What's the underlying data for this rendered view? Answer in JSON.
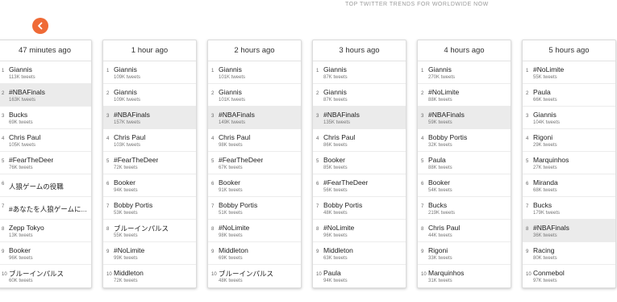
{
  "header": {
    "caption": "TOP TWITTER TRENDS FOR WORLDWIDE NOW"
  },
  "columns": [
    {
      "title": "47 minutes ago",
      "items": [
        {
          "rank": "1",
          "name": "Giannis",
          "count": "113K tweets"
        },
        {
          "rank": "2",
          "name": "#NBAFinals",
          "count": "163K tweets"
        },
        {
          "rank": "3",
          "name": "Bucks",
          "count": "69K tweets"
        },
        {
          "rank": "4",
          "name": "Chris Paul",
          "count": "105K tweets"
        },
        {
          "rank": "5",
          "name": "#FearTheDeer",
          "count": "76K tweets"
        },
        {
          "rank": "6",
          "name": "人狼ゲームの役職",
          "count": ""
        },
        {
          "rank": "7",
          "name": "#あなたを人狼ゲームに...",
          "count": ""
        },
        {
          "rank": "8",
          "name": "Zepp Tokyo",
          "count": "13K tweets"
        },
        {
          "rank": "9",
          "name": "Booker",
          "count": "96K tweets"
        },
        {
          "rank": "10",
          "name": "ブルーインパルス",
          "count": "60K tweets"
        }
      ]
    },
    {
      "title": "1 hour ago",
      "items": [
        {
          "rank": "1",
          "name": "Giannis",
          "count": "109K tweets"
        },
        {
          "rank": "2",
          "name": "Giannis",
          "count": "109K tweets"
        },
        {
          "rank": "3",
          "name": "#NBAFinals",
          "count": "157K tweets"
        },
        {
          "rank": "4",
          "name": "Chris Paul",
          "count": "103K tweets"
        },
        {
          "rank": "5",
          "name": "#FearTheDeer",
          "count": "72K tweets"
        },
        {
          "rank": "6",
          "name": "Booker",
          "count": "94K tweets"
        },
        {
          "rank": "7",
          "name": "Bobby Portis",
          "count": "53K tweets"
        },
        {
          "rank": "8",
          "name": "ブルーインパルス",
          "count": "55K tweets"
        },
        {
          "rank": "9",
          "name": "#NoLimite",
          "count": "99K tweets"
        },
        {
          "rank": "10",
          "name": "Middleton",
          "count": "72K tweets"
        }
      ]
    },
    {
      "title": "2 hours ago",
      "items": [
        {
          "rank": "1",
          "name": "Giannis",
          "count": "101K tweets"
        },
        {
          "rank": "2",
          "name": "Giannis",
          "count": "101K tweets"
        },
        {
          "rank": "3",
          "name": "#NBAFinals",
          "count": "149K tweets"
        },
        {
          "rank": "4",
          "name": "Chris Paul",
          "count": "98K tweets"
        },
        {
          "rank": "5",
          "name": "#FearTheDeer",
          "count": "67K tweets"
        },
        {
          "rank": "6",
          "name": "Booker",
          "count": "91K tweets"
        },
        {
          "rank": "7",
          "name": "Bobby Portis",
          "count": "51K tweets"
        },
        {
          "rank": "8",
          "name": "#NoLimite",
          "count": "98K tweets"
        },
        {
          "rank": "9",
          "name": "Middleton",
          "count": "69K tweets"
        },
        {
          "rank": "10",
          "name": "ブルーインパルス",
          "count": "48K tweets"
        }
      ]
    },
    {
      "title": "3 hours ago",
      "items": [
        {
          "rank": "1",
          "name": "Giannis",
          "count": "87K tweets"
        },
        {
          "rank": "2",
          "name": "Giannis",
          "count": "87K tweets"
        },
        {
          "rank": "3",
          "name": "#NBAFinals",
          "count": "135K tweets"
        },
        {
          "rank": "4",
          "name": "Chris Paul",
          "count": "86K tweets"
        },
        {
          "rank": "5",
          "name": "Booker",
          "count": "85K tweets"
        },
        {
          "rank": "6",
          "name": "#FearTheDeer",
          "count": "56K tweets"
        },
        {
          "rank": "7",
          "name": "Bobby Portis",
          "count": "48K tweets"
        },
        {
          "rank": "8",
          "name": "#NoLimite",
          "count": "96K tweets"
        },
        {
          "rank": "9",
          "name": "Middleton",
          "count": "63K tweets"
        },
        {
          "rank": "10",
          "name": "Paula",
          "count": "94K tweets"
        }
      ]
    },
    {
      "title": "4 hours ago",
      "items": [
        {
          "rank": "1",
          "name": "Giannis",
          "count": "270K tweets"
        },
        {
          "rank": "2",
          "name": "#NoLimite",
          "count": "88K tweets"
        },
        {
          "rank": "3",
          "name": "#NBAFinals",
          "count": "59K tweets"
        },
        {
          "rank": "4",
          "name": "Bobby Portis",
          "count": "32K tweets"
        },
        {
          "rank": "5",
          "name": "Paula",
          "count": "88K tweets"
        },
        {
          "rank": "6",
          "name": "Booker",
          "count": "54K tweets"
        },
        {
          "rank": "7",
          "name": "Bucks",
          "count": "219K tweets"
        },
        {
          "rank": "8",
          "name": "Chris Paul",
          "count": "44K tweets"
        },
        {
          "rank": "9",
          "name": "Rigoni",
          "count": "33K tweets"
        },
        {
          "rank": "10",
          "name": "Marquinhos",
          "count": "31K tweets"
        }
      ]
    },
    {
      "title": "5 hours ago",
      "items": [
        {
          "rank": "1",
          "name": "#NoLimite",
          "count": "55K tweets"
        },
        {
          "rank": "2",
          "name": "Paula",
          "count": "66K tweets"
        },
        {
          "rank": "3",
          "name": "Giannis",
          "count": "104K tweets"
        },
        {
          "rank": "4",
          "name": "Rigoni",
          "count": "29K tweets"
        },
        {
          "rank": "5",
          "name": "Marquinhos",
          "count": "27K tweets"
        },
        {
          "rank": "6",
          "name": "Miranda",
          "count": "68K tweets"
        },
        {
          "rank": "7",
          "name": "Bucks",
          "count": "179K tweets"
        },
        {
          "rank": "8",
          "name": "#NBAFinals",
          "count": "36K tweets"
        },
        {
          "rank": "9",
          "name": "Racing",
          "count": "80K tweets"
        },
        {
          "rank": "10",
          "name": "Conmebol",
          "count": "97K tweets"
        }
      ]
    }
  ],
  "highlight": {
    "term": "#NBAFinals",
    "color": "#ebebeb"
  },
  "accent_color": "#ef6a36",
  "icons": {
    "back": "chevron-left-icon"
  }
}
